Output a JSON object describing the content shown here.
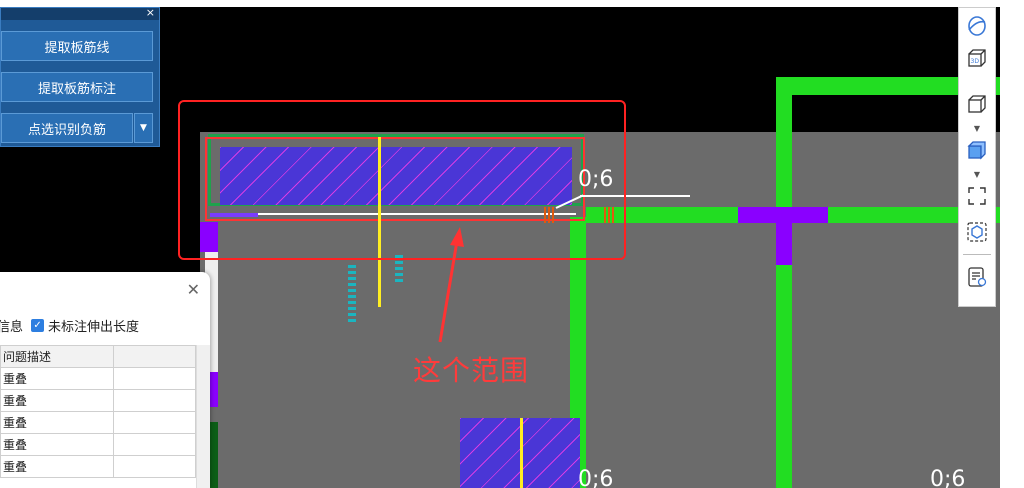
{
  "panel": {
    "close": "×",
    "buttons": [
      "提取板筋线",
      "提取板筋标注",
      "点选识别负筋"
    ],
    "dropdown": "▼"
  },
  "canvas": {
    "labels": [
      "0;6",
      "0;6",
      "0;6"
    ],
    "annotation": "这个范围",
    "annotation_color": "#ff2222",
    "highlight_color": "#ff3333"
  },
  "dialog": {
    "close": "✕",
    "option_partial": "信息",
    "checkbox_label": "未标注伸出长度",
    "checked": true,
    "table": {
      "header": "问题描述",
      "rows": [
        "重叠",
        "重叠",
        "重叠",
        "重叠",
        "重叠"
      ]
    }
  },
  "toolbar": {
    "icons": [
      "orbit-icon",
      "3d-view-icon",
      "box-view-icon",
      "solid-box-icon",
      "fullscreen-icon",
      "target-box-icon",
      "report-icon"
    ],
    "dropdown": "▼"
  }
}
